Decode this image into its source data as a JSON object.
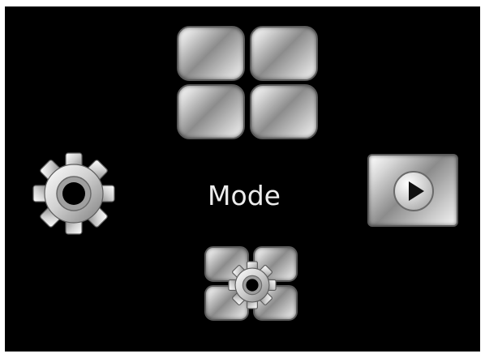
{
  "screen": {
    "mode_label": "Mode"
  },
  "icons": {
    "menu": "menu-grid-icon",
    "settings": "gear-icon",
    "playback": "play-icon",
    "setup": "setup-gear-grid-icon"
  },
  "colors": {
    "background": "#000000",
    "label_text": "#ececec",
    "metal_light": "#f4f4f4",
    "metal_dark": "#8c8c8c"
  }
}
